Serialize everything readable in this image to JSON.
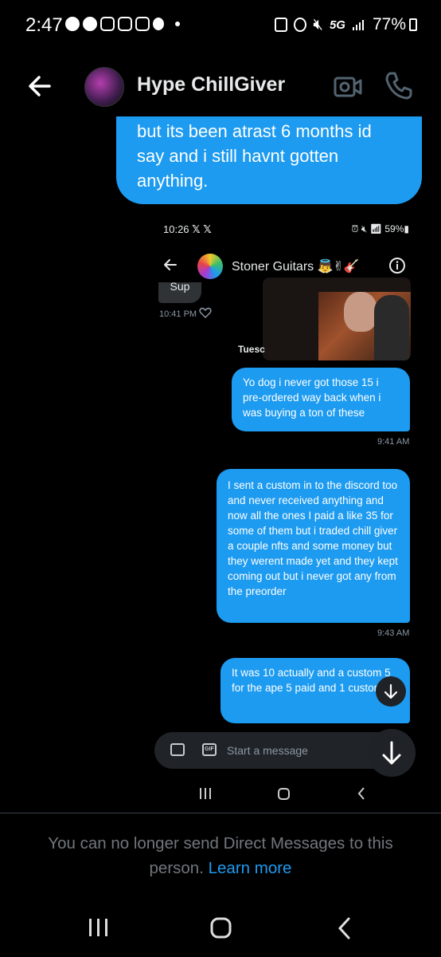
{
  "status_bar": {
    "time": "2:47",
    "network": "5G",
    "battery": "77%"
  },
  "header": {
    "title": "Hype ChillGiver"
  },
  "top_bubble": {
    "text": "but its been atrast 6 months id say and i still havnt gotten anything."
  },
  "embedded": {
    "status_time": "10:26",
    "status_x": "𝕏 𝕏",
    "status_battery": "59%",
    "header_title": "Stoner Guitars 👼✌🎸",
    "sup_text": "Sup",
    "sup_time": "10:41 PM",
    "day_label": "Tuesc",
    "messages": [
      {
        "text": "Yo dog i never got those 15 i pre-ordered way back when i was buying a ton of these",
        "time": "9:41 AM"
      },
      {
        "text": "I sent a custom in to the discord too and never received anything and now all the ones I paid a like 35 for some of them but i traded chill giver a couple nfts and some money but they werent made yet and they kept coming out but i never got any from the preorder",
        "time": "9:43 AM"
      },
      {
        "text": "It was 10 actually and a custom 5 for the ape 5 paid and 1 custom",
        "time": ""
      }
    ],
    "composer_placeholder": "Start a message",
    "gif_label": "GIF"
  },
  "notice": {
    "text": "You can no longer send Direct Messages to this person.",
    "link": "Learn more"
  },
  "colors": {
    "accent": "#1d9bf0",
    "background": "#000000",
    "muted": "#71767b"
  }
}
